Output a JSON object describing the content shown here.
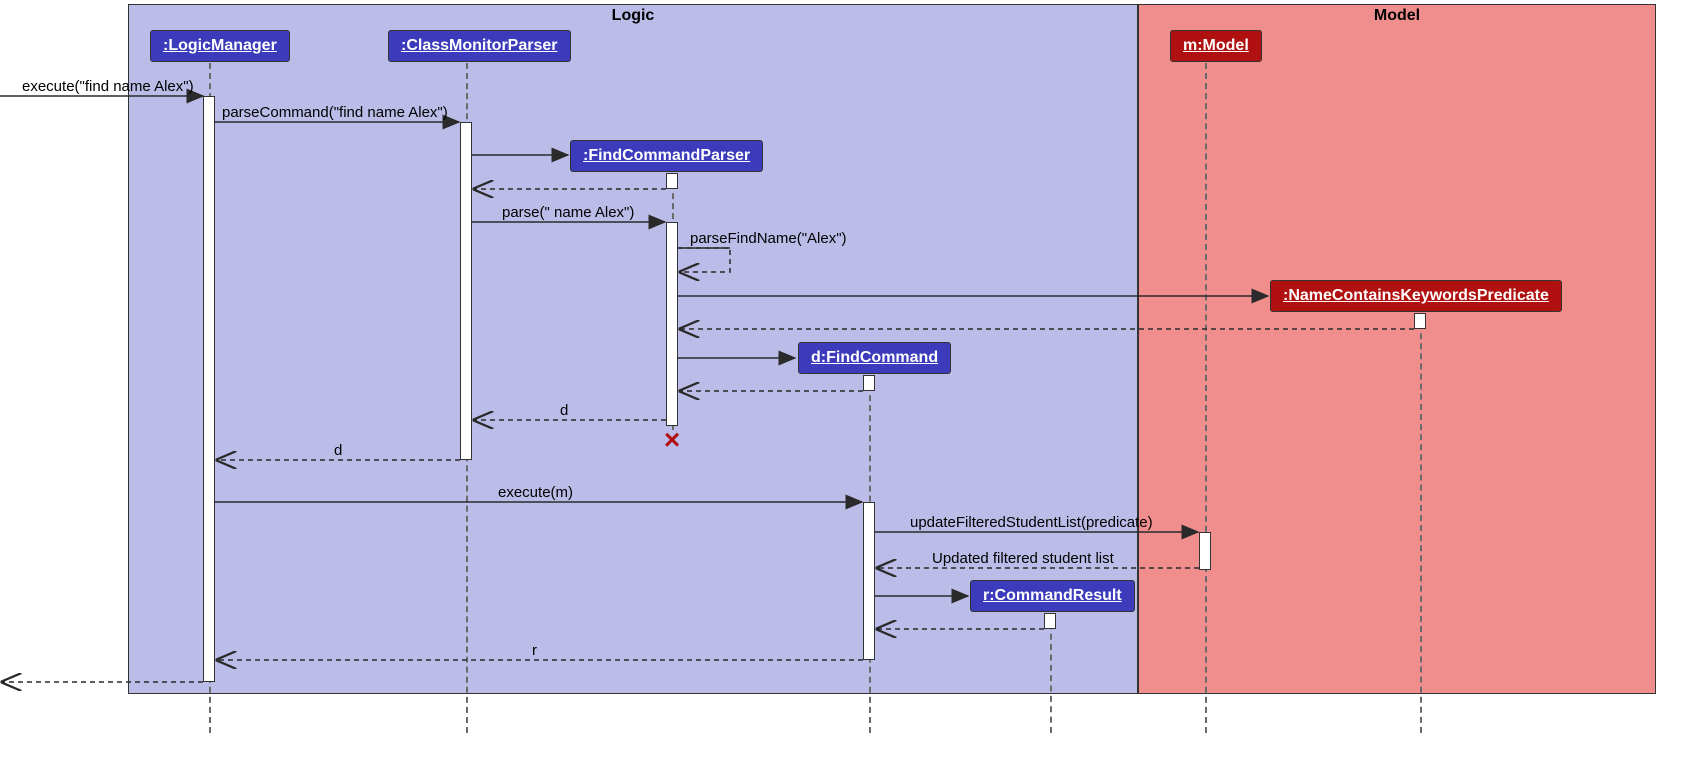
{
  "frames": {
    "logic": {
      "title": "Logic",
      "bg": "#bcbce9"
    },
    "model": {
      "title": "Model",
      "bg": "#f08e8e"
    }
  },
  "participants": {
    "logicManager": {
      "label": ":LogicManager"
    },
    "classMonitorParser": {
      "label": ":ClassMonitorParser"
    },
    "findCommandParser": {
      "label": ":FindCommandParser"
    },
    "findCommand": {
      "label": "d:FindCommand"
    },
    "commandResult": {
      "label": "r:CommandResult"
    },
    "predicate": {
      "label": ":NameContainsKeywordsPredicate"
    },
    "model": {
      "label": "m:Model"
    }
  },
  "messages": {
    "executeFind": "execute(\"find name Alex\")",
    "parseCommand": "parseCommand(\"find name Alex\")",
    "parse": "parse(\" name Alex\")",
    "parseFindName": "parseFindName(\"Alex\")",
    "d_return1": "d",
    "d_return2": "d",
    "executeM": "execute(m)",
    "updateFiltered": "updateFilteredStudentList(predicate)",
    "updatedList": "Updated filtered student list",
    "r_return": "r"
  }
}
